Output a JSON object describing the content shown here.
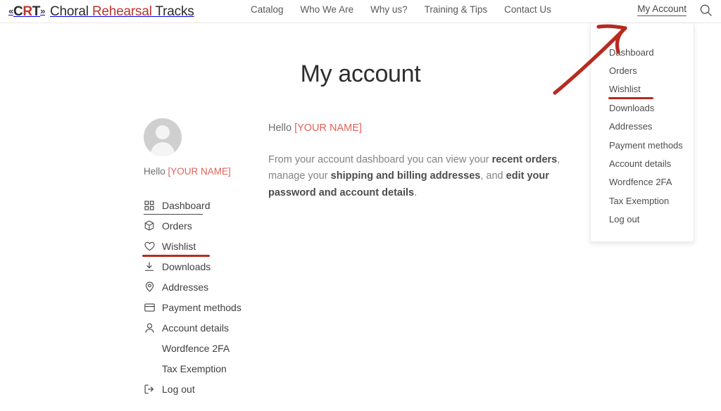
{
  "colors": {
    "brand_red": "#b9372c",
    "annotation_red": "#b62b20",
    "placeholder_red": "#e06257",
    "text_dark": "#2e2e2e",
    "text_muted": "#838383"
  },
  "header": {
    "brand": {
      "mark_left": "«",
      "mark_c": "C",
      "mark_r": "R",
      "mark_t": "T",
      "mark_right": "»",
      "word_one": "Choral",
      "word_two": "Rehearsal",
      "word_three": "Tracks"
    },
    "nav": [
      {
        "label": "Catalog"
      },
      {
        "label": "Who We Are"
      },
      {
        "label": "Why us?"
      },
      {
        "label": "Training & Tips"
      },
      {
        "label": "Contact Us"
      }
    ],
    "my_account_label": "My Account",
    "search_icon": "search-icon"
  },
  "page": {
    "title": "My account"
  },
  "aside": {
    "avatar_icon": "user-avatar-placeholder",
    "hello_prefix": "Hello ",
    "hello_placeholder": "[YOUR NAME]",
    "menu": [
      {
        "label": "Dashboard",
        "icon": "grid-icon",
        "state": "active"
      },
      {
        "label": "Orders",
        "icon": "box-icon",
        "state": ""
      },
      {
        "label": "Wishlist",
        "icon": "heart-icon",
        "state": "annotated"
      },
      {
        "label": "Downloads",
        "icon": "download-icon",
        "state": ""
      },
      {
        "label": "Addresses",
        "icon": "map-pin-icon",
        "state": ""
      },
      {
        "label": "Payment methods",
        "icon": "credit-card-icon",
        "state": ""
      },
      {
        "label": "Account details",
        "icon": "user-icon",
        "state": ""
      },
      {
        "label": "Wordfence 2FA",
        "icon": "",
        "state": ""
      },
      {
        "label": "Tax Exemption",
        "icon": "",
        "state": ""
      },
      {
        "label": "Log out",
        "icon": "logout-icon",
        "state": ""
      }
    ]
  },
  "content": {
    "greeting_prefix": "Hello ",
    "greeting_placeholder": "[YOUR NAME]",
    "description": {
      "seg1": "From your account dashboard you can view your ",
      "bold1": "recent orders",
      "seg2": ", manage your ",
      "bold2": "shipping and billing addresses",
      "seg3": ", and ",
      "bold3": "edit your password and account details",
      "seg4": "."
    }
  },
  "dropdown": {
    "items": [
      {
        "label": "Dashboard",
        "state": ""
      },
      {
        "label": "Orders",
        "state": ""
      },
      {
        "label": "Wishlist",
        "state": "annotated"
      },
      {
        "label": "Downloads",
        "state": ""
      },
      {
        "label": "Addresses",
        "state": ""
      },
      {
        "label": "Payment methods",
        "state": ""
      },
      {
        "label": "Account details",
        "state": ""
      },
      {
        "label": "Wordfence 2FA",
        "state": ""
      },
      {
        "label": "Tax Exemption",
        "state": ""
      },
      {
        "label": "Log out",
        "state": ""
      }
    ]
  },
  "annotations": {
    "arrow": "red-curved-arrow-pointing-to-account-menu",
    "underline_sidebar": "red-underline-wishlist-sidebar",
    "underline_dropdown": "red-underline-wishlist-dropdown"
  }
}
